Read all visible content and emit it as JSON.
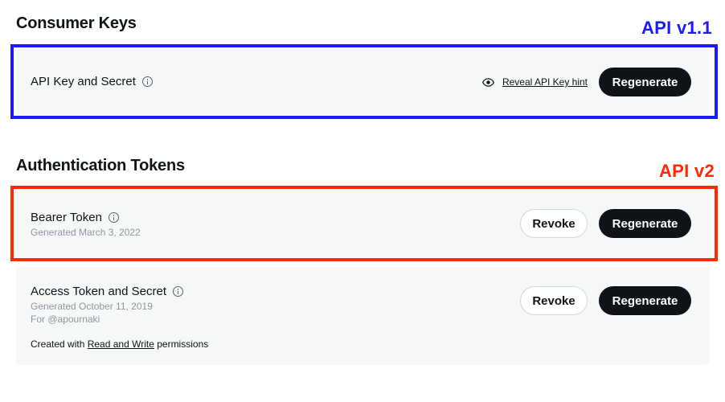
{
  "consumer_keys": {
    "section_title": "Consumer Keys",
    "version_label": "API v1.1",
    "api_key": {
      "label": "API Key and Secret",
      "reveal_link": "Reveal API Key hint",
      "regenerate_label": "Regenerate"
    }
  },
  "auth_tokens": {
    "section_title": "Authentication Tokens",
    "version_label": "API v2",
    "bearer": {
      "label": "Bearer Token",
      "generated": "Generated March 3, 2022",
      "revoke_label": "Revoke",
      "regenerate_label": "Regenerate"
    },
    "access": {
      "label": "Access Token and Secret",
      "generated": "Generated October 11, 2019",
      "for_user": "For @apournaki",
      "created_prefix": "Created with",
      "permissions_link": "Read and Write",
      "created_suffix": "permissions",
      "revoke_label": "Revoke",
      "regenerate_label": "Regenerate"
    }
  },
  "colors": {
    "v11_outline": "#1a1aff",
    "v2_outline": "#ff2a00",
    "button_dark": "#0f1419",
    "card_bg": "#f6f7f7"
  },
  "icons": [
    "info-icon",
    "eye-icon"
  ]
}
